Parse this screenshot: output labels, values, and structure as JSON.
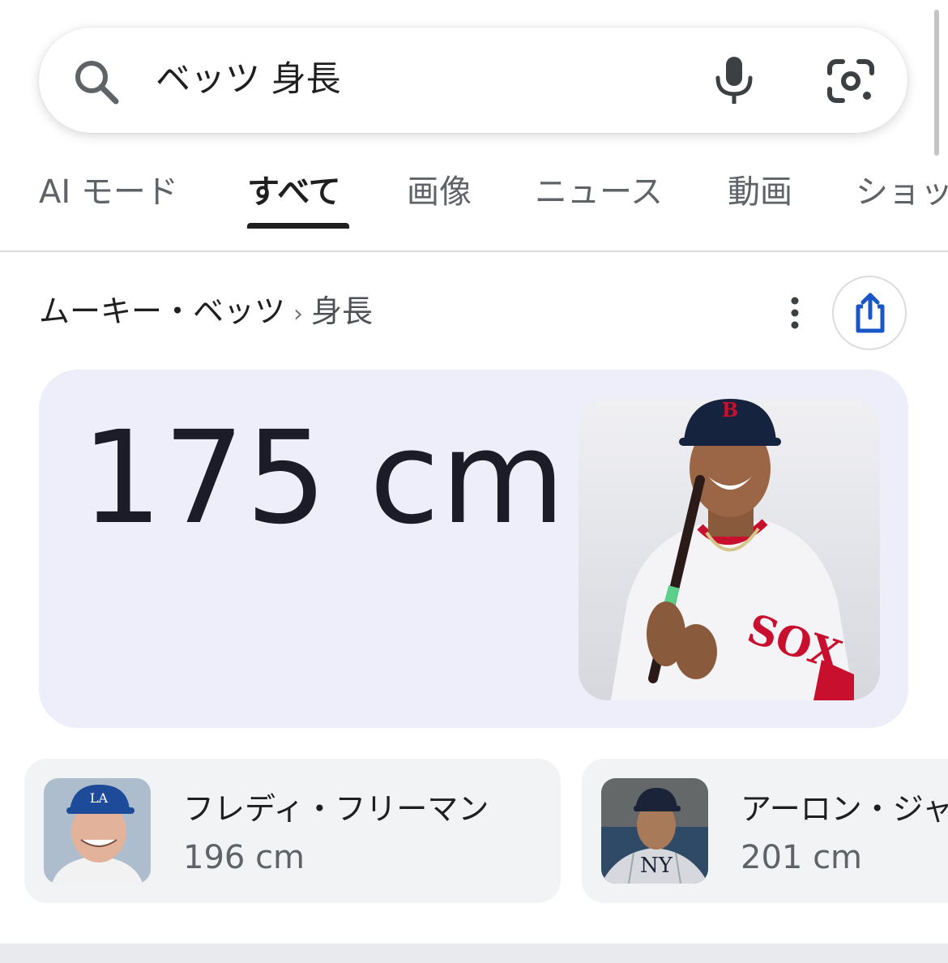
{
  "search": {
    "query": "ベッツ 身長",
    "icons": [
      "search-icon",
      "microphone-icon",
      "google-lens-icon"
    ]
  },
  "tabs": [
    {
      "label": "AI モード",
      "active": false
    },
    {
      "label": "すべて",
      "active": true
    },
    {
      "label": "画像",
      "active": false
    },
    {
      "label": "ニュース",
      "active": false
    },
    {
      "label": "動画",
      "active": false
    },
    {
      "label": "ショッ",
      "active": false
    }
  ],
  "breadcrumb": {
    "entity": "ムーキー・ベッツ",
    "separator": "›",
    "attribute": "身長"
  },
  "answer": {
    "value": "175 cm",
    "image": "player-photo"
  },
  "related": [
    {
      "name": "フレディ・フリーマン",
      "height": "196 cm",
      "image": "player-thumbnail"
    },
    {
      "name": "アーロン・ジャ",
      "height": "201 cm",
      "image": "player-thumbnail"
    }
  ],
  "colors": {
    "accent_blue": "#1a56c8",
    "answer_card_bg": "#eeeefb",
    "related_card_bg": "#f1f3f4",
    "text_primary": "#1f1f1f",
    "text_secondary": "#5f6368"
  }
}
